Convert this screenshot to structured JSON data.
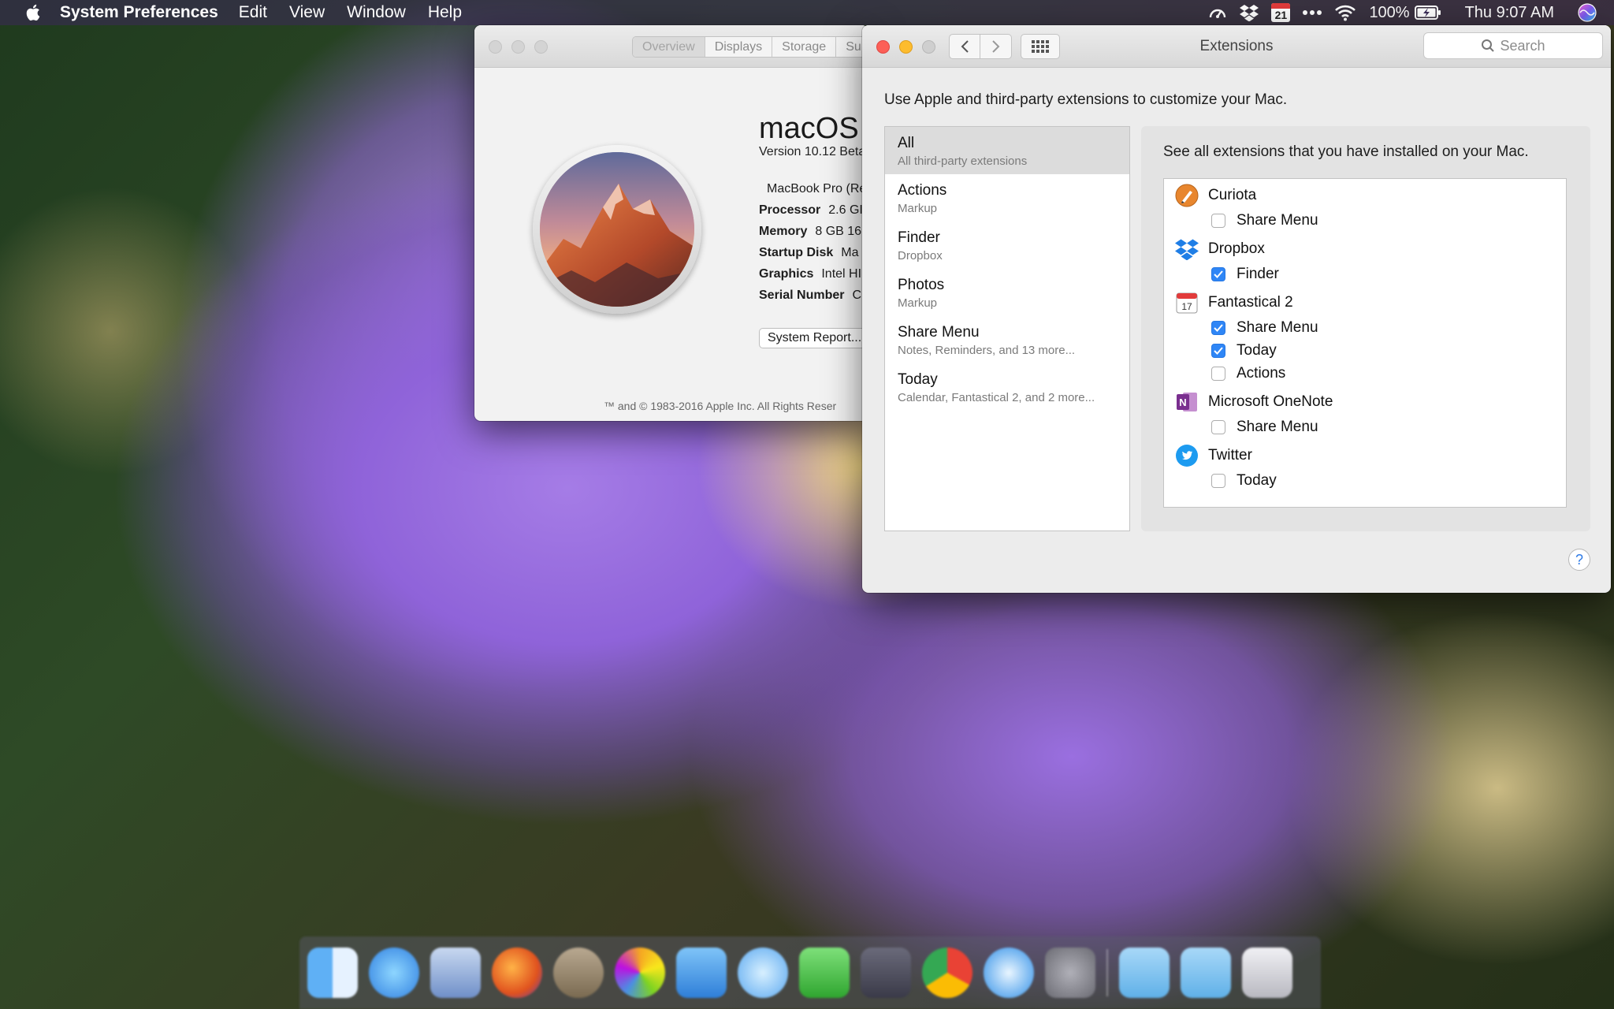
{
  "menubar": {
    "app_name": "System Preferences",
    "menus": [
      "Edit",
      "View",
      "Window",
      "Help"
    ],
    "calendar_day": "21",
    "battery_percent": "100%",
    "clock": "Thu 9:07 AM"
  },
  "about_window": {
    "tabs": [
      "Overview",
      "Displays",
      "Storage",
      "Su"
    ],
    "os_title": "macOS S",
    "version": "Version 10.12 Beta",
    "specs": [
      {
        "label": "",
        "value": "MacBook Pro (Re"
      },
      {
        "label": "Processor",
        "value": "2.6 GI"
      },
      {
        "label": "Memory",
        "value": "8 GB 16"
      },
      {
        "label": "Startup Disk",
        "value": "Ma"
      },
      {
        "label": "Graphics",
        "value": "Intel HI"
      },
      {
        "label": "Serial Number",
        "value": "C"
      }
    ],
    "system_report_button": "System Report...",
    "copyright": "™ and © 1983-2016 Apple Inc. All Rights Reser"
  },
  "extensions_window": {
    "title": "Extensions",
    "search_placeholder": "Search",
    "intro": "Use Apple and third-party extensions to customize your Mac.",
    "sidebar": [
      {
        "name": "All",
        "sub": "All third-party extensions",
        "selected": true
      },
      {
        "name": "Actions",
        "sub": "Markup",
        "selected": false
      },
      {
        "name": "Finder",
        "sub": "Dropbox",
        "selected": false
      },
      {
        "name": "Photos",
        "sub": "Markup",
        "selected": false
      },
      {
        "name": "Share Menu",
        "sub": "Notes, Reminders, and 13 more...",
        "selected": false
      },
      {
        "name": "Today",
        "sub": "Calendar, Fantastical 2, and 2 more...",
        "selected": false
      }
    ],
    "detail_heading": "See all extensions that you have installed on your Mac.",
    "apps": [
      {
        "name": "Curiota",
        "icon": "curiota-icon",
        "extensions": [
          {
            "name": "Share Menu",
            "checked": false
          }
        ]
      },
      {
        "name": "Dropbox",
        "icon": "dropbox-icon",
        "extensions": [
          {
            "name": "Finder",
            "checked": true
          }
        ]
      },
      {
        "name": "Fantastical 2",
        "icon": "fantastical-icon",
        "extensions": [
          {
            "name": "Share Menu",
            "checked": true
          },
          {
            "name": "Today",
            "checked": true
          },
          {
            "name": "Actions",
            "checked": false
          }
        ]
      },
      {
        "name": "Microsoft OneNote",
        "icon": "onenote-icon",
        "extensions": [
          {
            "name": "Share Menu",
            "checked": false
          }
        ]
      },
      {
        "name": "Twitter",
        "icon": "twitter-icon",
        "extensions": [
          {
            "name": "Today",
            "checked": false
          }
        ]
      }
    ],
    "fantastical_icon_day": "17",
    "onenote_icon_letter": "N",
    "help_label": "?"
  },
  "colors": {
    "accent_blue": "#2f86f6",
    "close_red": "#fc5f57",
    "minimize_yellow": "#fdbc2e"
  }
}
